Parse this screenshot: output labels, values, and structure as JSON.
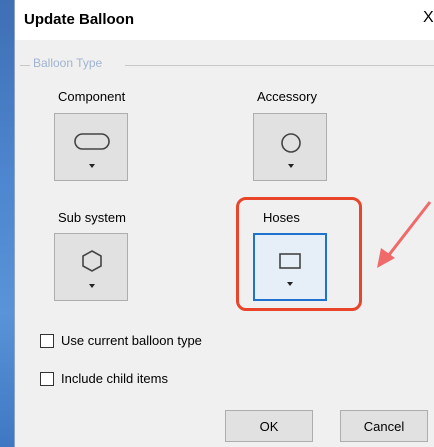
{
  "dialog": {
    "title": "Update Balloon",
    "close_glyph": "X"
  },
  "balloon_type_group": {
    "label": "Balloon Type",
    "options": [
      {
        "label": "Component",
        "shape": "rounded-rectangle-icon",
        "selected": false
      },
      {
        "label": "Accessory",
        "shape": "circle-icon",
        "selected": false
      },
      {
        "label": "Sub system",
        "shape": "hexagon-icon",
        "selected": false
      },
      {
        "label": "Hoses",
        "shape": "rectangle-icon",
        "selected": true
      }
    ]
  },
  "checkboxes": [
    {
      "label": "Use current balloon type",
      "checked": false
    },
    {
      "label": "Include child items",
      "checked": false
    }
  ],
  "buttons": {
    "ok": "OK",
    "cancel": "Cancel"
  },
  "annotation": {
    "highlight_color": "#e8452b",
    "arrow_color": "#f06a6a"
  }
}
